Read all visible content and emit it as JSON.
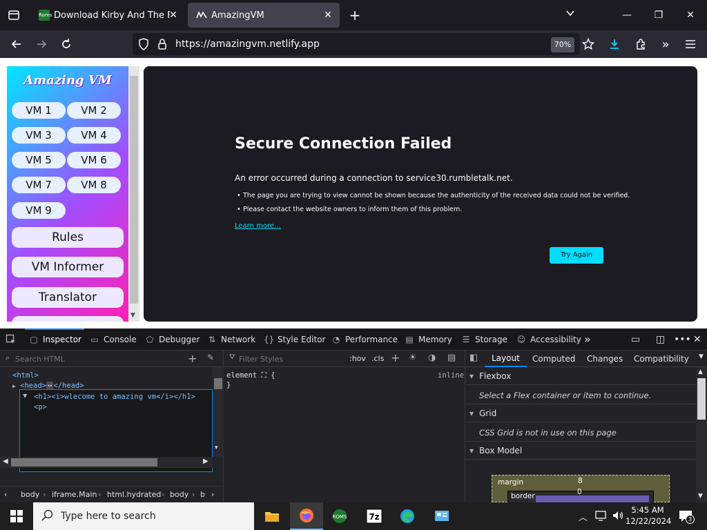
{
  "browser": {
    "tabs": [
      {
        "title": "Download Kirby And The Forgo",
        "favicon_text": "Roms",
        "active": false
      },
      {
        "title": "AmazingVM",
        "active": true
      }
    ],
    "url": "https://amazingvm.netlify.app",
    "zoom": "70%"
  },
  "sidebar": {
    "logo": "Amazing VM",
    "vm_buttons": [
      "VM 1",
      "VM 2",
      "VM 3",
      "VM 4",
      "VM 5",
      "VM 6",
      "VM 7",
      "VM 8",
      "VM 9"
    ],
    "big_buttons": [
      "Rules",
      "VM Informer",
      "Translator"
    ]
  },
  "error": {
    "title": "Secure Connection Failed",
    "description": "An error occurred during a connection to service30.rumbletalk.net.",
    "bullets": [
      "The page you are trying to view cannot be shown because the authenticity of the received data could not be verified.",
      "Please contact the website owners to inform them of this problem."
    ],
    "learn_more": "Learn more…",
    "try_again": "Try Again"
  },
  "devtools": {
    "tabs": [
      "Inspector",
      "Console",
      "Debugger",
      "Network",
      "Style Editor",
      "Performance",
      "Memory",
      "Storage",
      "Accessibility"
    ],
    "search_placeholder": "Search HTML",
    "tree": {
      "html": "<html>",
      "head": "<head>",
      "head_ellipsis": "⋯",
      "head_close": "</head>",
      "edit_line1": "<h1><i>wlecome to amazing vm</i></h1>",
      "edit_line2": "<p>"
    },
    "breadcrumbs": [
      "body",
      "iframe.Main",
      "html.hydrated",
      "body",
      "b"
    ],
    "styles": {
      "filter_placeholder": "Filter Styles",
      "hov": ":hov",
      "cls": ".cls",
      "rule": "element ⛶ {",
      "close": "}",
      "inline": "inline"
    },
    "layout": {
      "tabs": [
        "Layout",
        "Computed",
        "Changes",
        "Compatibility"
      ],
      "sections": [
        {
          "title": "Flexbox",
          "note": "Select a Flex container or item to continue."
        },
        {
          "title": "Grid",
          "note": "CSS Grid is not in use on this page"
        },
        {
          "title": "Box Model",
          "note": ""
        }
      ],
      "box_model": {
        "margin_label": "margin",
        "margin_value": "8",
        "border_label": "border",
        "border_value": "0"
      }
    }
  },
  "taskbar": {
    "search_placeholder": "Type here to search",
    "time": "5:45 AM",
    "date": "12/22/2024",
    "notification_count": "3"
  }
}
